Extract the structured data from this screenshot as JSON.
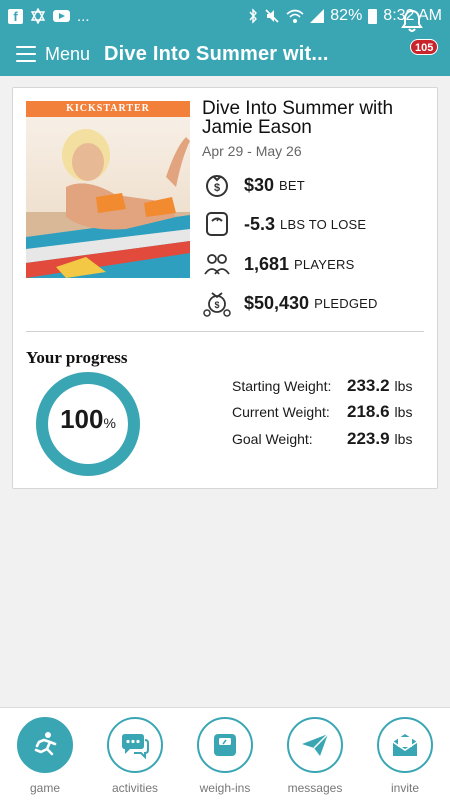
{
  "status_bar": {
    "battery": "82%",
    "time": "8:32 AM",
    "dots": "..."
  },
  "header": {
    "menu_label": "Menu",
    "title": "Dive Into Summer wit...",
    "notifications": "105"
  },
  "game": {
    "banner": "KICKSTARTER",
    "title": "Dive Into Summer with Jamie Eason",
    "dates": "Apr 29 - May 26",
    "stats": [
      {
        "icon": "money-bag-icon",
        "value": "$30",
        "unit": "BET"
      },
      {
        "icon": "scale-icon",
        "value": "-5.3",
        "unit": "LBS TO LOSE"
      },
      {
        "icon": "players-icon",
        "value": "1,681",
        "unit": "PLAYERS"
      },
      {
        "icon": "pledge-icon",
        "value": "$50,430",
        "unit": "PLEDGED"
      }
    ]
  },
  "progress": {
    "label": "Your progress",
    "percent": "100",
    "percent_symbol": "%",
    "percent_value": 100,
    "rows": [
      {
        "label": "Starting Weight:",
        "value": "233.2",
        "unit": "lbs"
      },
      {
        "label": "Current Weight:",
        "value": "218.6",
        "unit": "lbs"
      },
      {
        "label": "Goal Weight:",
        "value": "223.9",
        "unit": "lbs"
      }
    ]
  },
  "tabs": [
    {
      "label": "game",
      "icon": "runner-icon",
      "active": true
    },
    {
      "label": "activities",
      "icon": "chat-bubbles-icon",
      "active": false
    },
    {
      "label": "weigh-ins",
      "icon": "scale-icon",
      "active": false
    },
    {
      "label": "messages",
      "icon": "paper-plane-icon",
      "active": false
    },
    {
      "label": "invite",
      "icon": "envelope-icon",
      "active": false
    }
  ],
  "colors": {
    "primary": "#3aa6b4",
    "badge": "#c9232b",
    "banner": "#f2803b"
  }
}
